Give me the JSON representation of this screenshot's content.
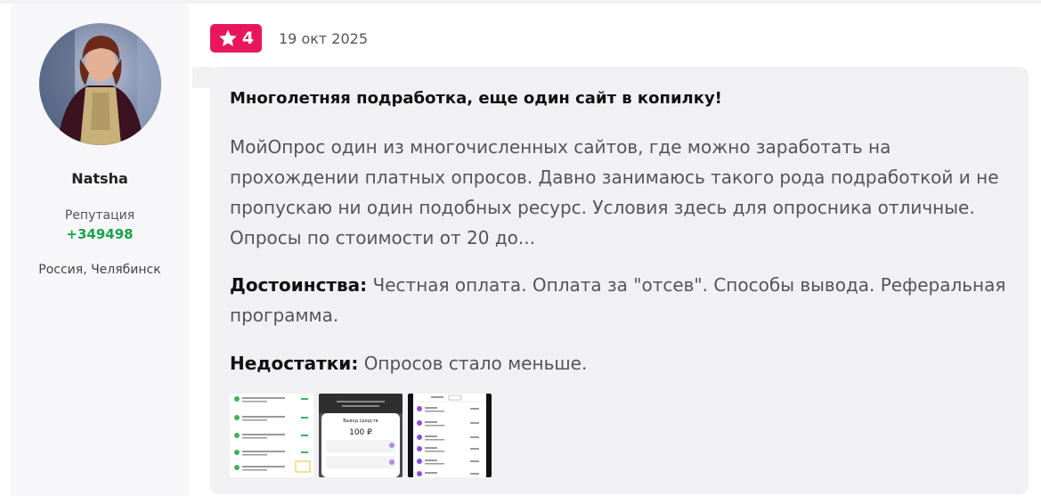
{
  "user": {
    "name": "Natsha",
    "reputation_label": "Репутация",
    "reputation_value": "+349498",
    "location": "Россия, Челябинск",
    "avatar_icon": "user-avatar-photo"
  },
  "review": {
    "rating": "4",
    "rating_icon": "star-icon",
    "date": "19 окт 2025",
    "title": "Многолетняя подработка, еще один сайт в копилку!",
    "body": "МойОпрос один из многочисленных сайтов, где можно заработать на прохождении платных опросов. Давно занимаюсь такого рода подработкой и не пропускаю ни один подобных ресурс. Условия здесь для опросника отличные. Опросы по стоимости от 20 до...",
    "pros_label": "Достоинства:",
    "pros_text": "Честная оплата. Оплата за \"отсев\". Способы вывода. Реферальная программа.",
    "cons_label": "Недостатки:",
    "cons_text": "Опросов стало меньше.",
    "thumbnails": [
      {
        "name": "screenshot-payments-list"
      },
      {
        "name": "screenshot-withdraw-dialog",
        "amount": "100 ₽",
        "heading": "Вывод средств"
      },
      {
        "name": "screenshot-history-list"
      }
    ]
  },
  "colors": {
    "rating_badge": "#e8175d",
    "reputation": "#1aa34a",
    "bubble_bg": "#f1f1f4"
  }
}
